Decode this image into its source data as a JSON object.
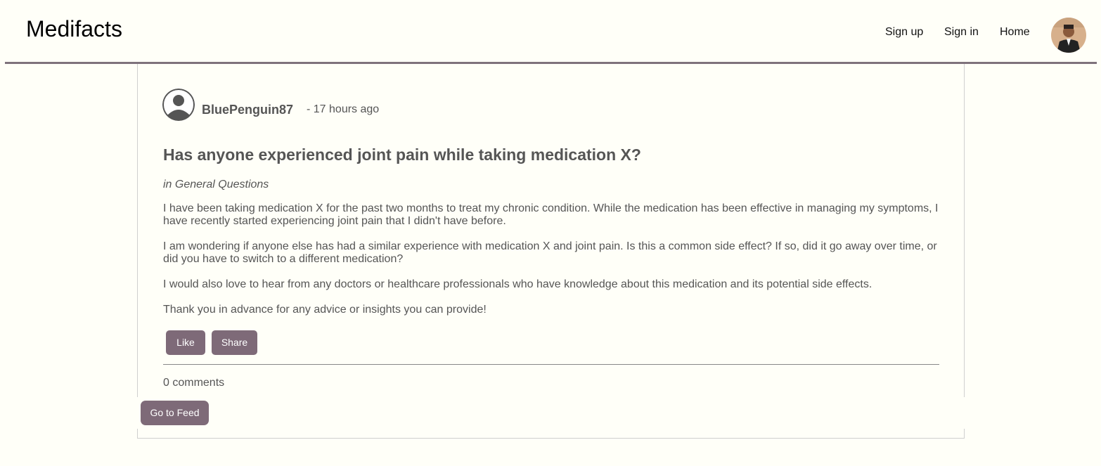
{
  "header": {
    "brand": "Medifacts",
    "nav": {
      "signup": "Sign up",
      "signin": "Sign in",
      "home": "Home"
    },
    "profile_icon": "user-photo-avatar"
  },
  "post": {
    "author": "BluePenguin87",
    "time": "- 17 hours ago",
    "author_icon": "default-user-avatar-icon",
    "title": "Has anyone experienced joint pain while taking medication X?",
    "category": "in General Questions",
    "paragraphs": [
      "I have been taking medication X for the past two months to treat my chronic condition. While the medication has been effective in managing my symptoms, I have recently started experiencing joint pain that I didn't have before.",
      "I am wondering if anyone else has had a similar experience with medication X and joint pain. Is this a common side effect? If so, did it go away over time, or did you have to switch to a different medication?",
      "I would also love to hear from any doctors or healthcare professionals who have knowledge about this medication and its potential side effects.",
      "Thank you in advance for any advice or insights you can provide!"
    ],
    "like_label": "Like",
    "share_label": "Share",
    "comments_label": "0 comments"
  },
  "footer": {
    "feed_label": "Go to Feed"
  },
  "colors": {
    "accent": "#7e6a78",
    "header_border": "#7e727c",
    "background": "#fffff8",
    "text": "#555555"
  }
}
